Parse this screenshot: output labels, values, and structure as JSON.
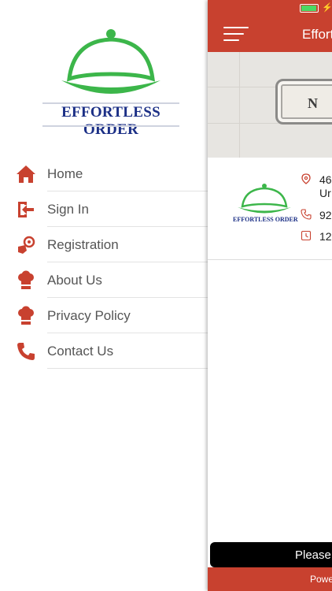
{
  "drawer": {
    "logo_text": "EFFORTLESS ORDER",
    "menu": [
      {
        "label": "Home",
        "icon": "home-icon"
      },
      {
        "label": "Sign In",
        "icon": "sign-in-icon"
      },
      {
        "label": "Registration",
        "icon": "registration-icon"
      },
      {
        "label": "About Us",
        "icon": "chef-hat-icon"
      },
      {
        "label": "Privacy Policy",
        "icon": "chef-hat-icon"
      },
      {
        "label": "Contact Us",
        "icon": "phone-icon"
      }
    ]
  },
  "main": {
    "title": "Effortless Order",
    "banner_text": "N",
    "mini_logo_text": "EFFORTLESS ORDER",
    "info": {
      "address_line1": "46",
      "address_line2": "Ur",
      "phone": "92",
      "hours": "12"
    },
    "toast": "Please",
    "footer": "Powered"
  },
  "colors": {
    "brand_red": "#c8412f",
    "logo_green": "#3cb64a",
    "logo_blue": "#1b2f86"
  }
}
